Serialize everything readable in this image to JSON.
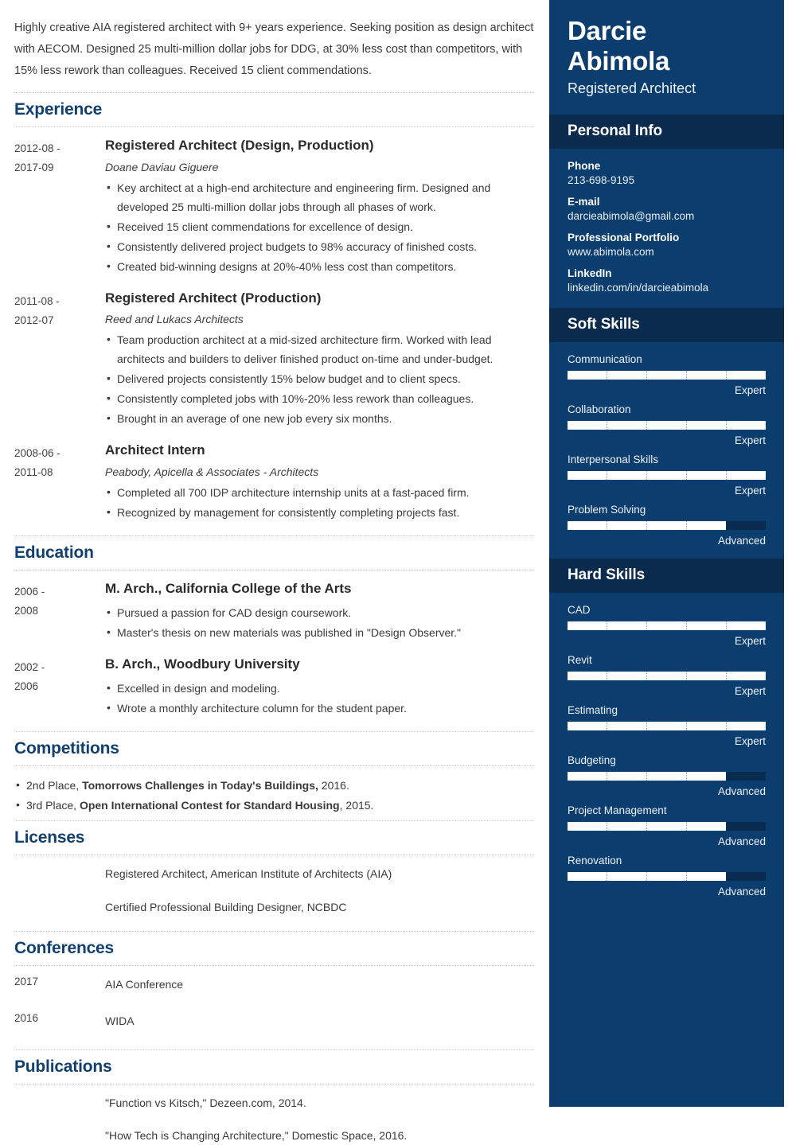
{
  "summary": "Highly creative AIA registered architect with 9+ years experience. Seeking position as design architect with AECOM. Designed 25 multi-million dollar jobs for DDG, at 30% less cost than competitors, with 15% less rework than colleagues. Received 15 client commendations.",
  "sections": {
    "experience": "Experience",
    "education": "Education",
    "competitions": "Competitions",
    "licenses": "Licenses",
    "conferences": "Conferences",
    "publications": "Publications"
  },
  "experience": [
    {
      "date_start": "2012-08 -",
      "date_end": "2017-09",
      "title": "Registered Architect (Design, Production)",
      "company": "Doane Daviau Giguere",
      "bullets": [
        "Key architect at a high-end architecture and engineering firm. Designed and developed 25 multi-million dollar jobs through all phases of work.",
        "Received 15 client commendations for excellence of design.",
        "Consistently delivered project budgets to 98% accuracy of finished costs.",
        "Created bid-winning designs at 20%-40% less cost than competitors."
      ]
    },
    {
      "date_start": "2011-08 -",
      "date_end": "2012-07",
      "title": "Registered Architect (Production)",
      "company": "Reed and Lukacs Architects",
      "bullets": [
        "Team production architect at a mid-sized architecture firm. Worked with lead architects and builders to deliver finished product on-time and under-budget.",
        "Delivered projects consistently 15% below budget and to client specs.",
        "Consistently completed jobs with 10%-20% less rework than colleagues.",
        "Brought in an average of one new job every six months."
      ]
    },
    {
      "date_start": "2008-06 -",
      "date_end": "2011-08",
      "title": "Architect Intern",
      "company": "Peabody, Apicella & Associates - Architects",
      "bullets": [
        "Completed all 700 IDP architecture internship units at a fast-paced firm.",
        "Recognized by management for consistently completing projects fast."
      ]
    }
  ],
  "education": [
    {
      "date_start": "2006 -",
      "date_end": "2008",
      "title": "M. Arch., California College of the Arts",
      "bullets": [
        "Pursued a passion for CAD design coursework.",
        "Master's thesis on new materials was published in \"Design Observer.\""
      ]
    },
    {
      "date_start": "2002 -",
      "date_end": "2006",
      "title": "B. Arch., Woodbury University",
      "bullets": [
        "Excelled in design and modeling.",
        "Wrote a monthly architecture column for the student paper."
      ]
    }
  ],
  "competitions": [
    {
      "prefix": "2nd Place, ",
      "bold": "Tomorrows Challenges in Today's Buildings,",
      "suffix": " 2016."
    },
    {
      "prefix": "3rd Place, ",
      "bold": "Open International Contest for Standard Housing",
      "suffix": ", 2015."
    }
  ],
  "licenses": [
    "Registered Architect, American Institute of Architects (AIA)",
    "Certified Professional Building Designer, NCBDC"
  ],
  "conferences": [
    {
      "year": "2017",
      "name": "AIA Conference"
    },
    {
      "year": "2016",
      "name": "WIDA"
    }
  ],
  "publications": [
    "\"Function vs Kitsch,\" Dezeen.com, 2014.",
    "\"How Tech is Changing Architecture,\" Domestic Space, 2016."
  ],
  "sidebar": {
    "name_line1": "Darcie",
    "name_line2": "Abimola",
    "role": "Registered Architect",
    "personal_info_title": "Personal Info",
    "personal_info": [
      {
        "label": "Phone",
        "value": "213-698-9195"
      },
      {
        "label": "E-mail",
        "value": "darcieabimola@gmail.com"
      },
      {
        "label": "Professional Portfolio",
        "value": "www.abimola.com"
      },
      {
        "label": "LinkedIn",
        "value": "linkedin.com/in/darcieabimola"
      }
    ],
    "soft_skills_title": "Soft Skills",
    "soft_skills": [
      {
        "name": "Communication",
        "level": "Expert",
        "percent": 100
      },
      {
        "name": "Collaboration",
        "level": "Expert",
        "percent": 100
      },
      {
        "name": "Interpersonal Skills",
        "level": "Expert",
        "percent": 100
      },
      {
        "name": "Problem Solving",
        "level": "Advanced",
        "percent": 80
      }
    ],
    "hard_skills_title": "Hard Skills",
    "hard_skills": [
      {
        "name": "CAD",
        "level": "Expert",
        "percent": 100
      },
      {
        "name": "Revit",
        "level": "Expert",
        "percent": 100
      },
      {
        "name": "Estimating",
        "level": "Expert",
        "percent": 100
      },
      {
        "name": "Budgeting",
        "level": "Advanced",
        "percent": 80
      },
      {
        "name": "Project Management",
        "level": "Advanced",
        "percent": 80
      },
      {
        "name": "Renovation",
        "level": "Advanced",
        "percent": 80
      }
    ],
    "colors": {
      "sidebar_bg": "#0b3d6e",
      "band_bg": "#0a2a4e",
      "bar_fill": "#ffffff",
      "bar_track": "#0a2b50",
      "heading": "#12406e"
    }
  }
}
